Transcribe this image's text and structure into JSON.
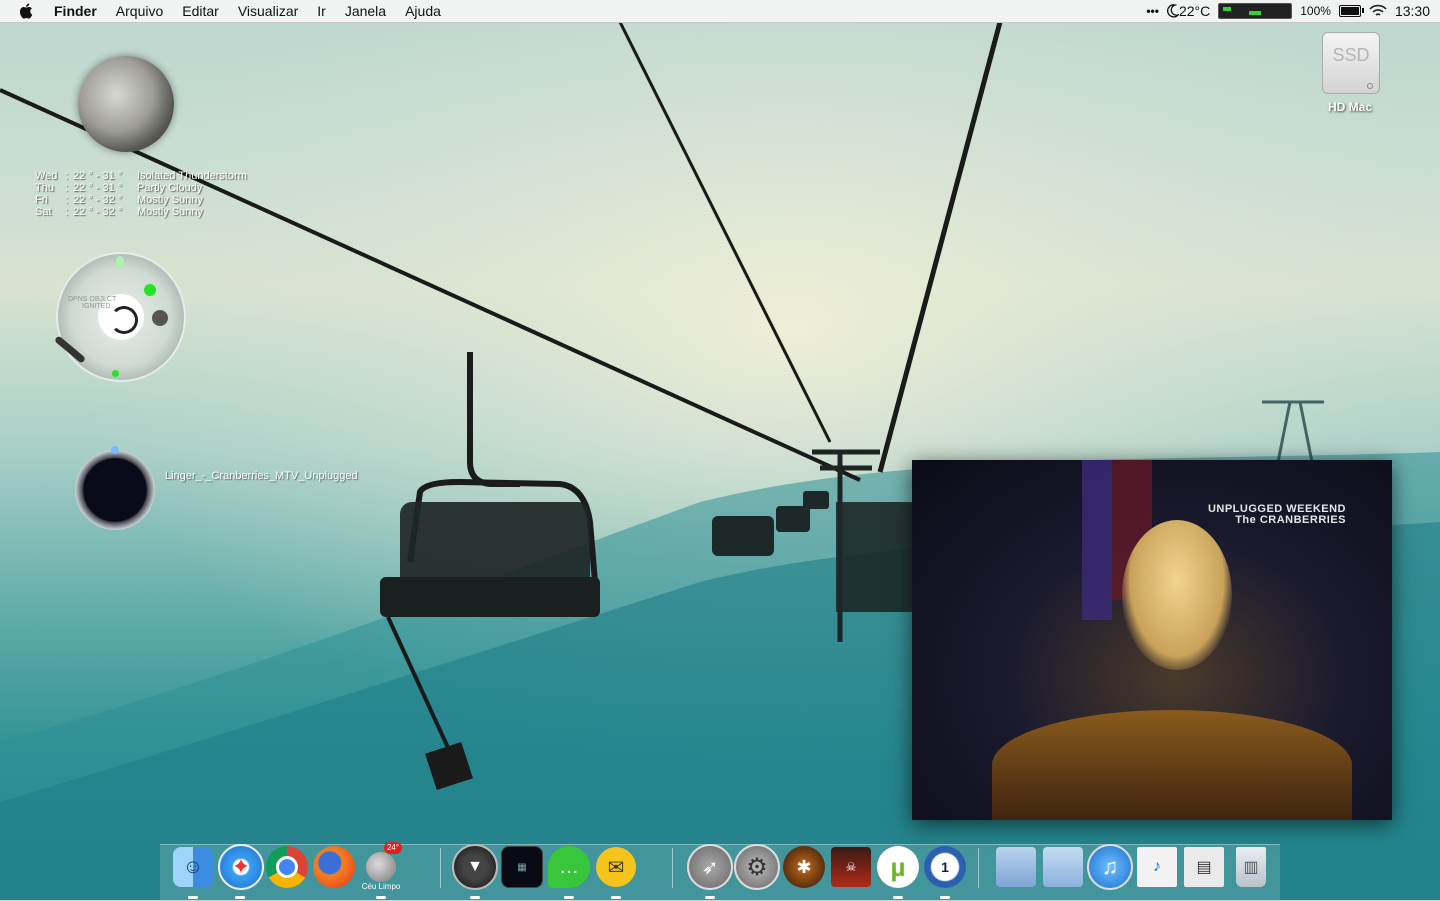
{
  "menubar": {
    "app_name": "Finder",
    "items": [
      "Arquivo",
      "Editar",
      "Visualizar",
      "Ir",
      "Janela",
      "Ajuda"
    ],
    "status": {
      "dots": "•••",
      "temperature": "22°C",
      "battery_percent": "100%",
      "time": "13:30"
    }
  },
  "weather_widget": {
    "rows": [
      {
        "day": "Wed",
        "temps": "22 ° - 31 °",
        "condition": "Isolated Thunderstorm"
      },
      {
        "day": "Thu",
        "temps": "22 ° - 31 °",
        "condition": "Partly Cloudy"
      },
      {
        "day": "Fri",
        "temps": "22 ° - 32 °",
        "condition": "Mostly Sunny"
      },
      {
        "day": "Sat",
        "temps": "22 ° - 32 °",
        "condition": "Mostly Sunny"
      }
    ]
  },
  "clock_widget": {
    "labels": [
      "DPNS OBJLCT",
      "IGNITED"
    ]
  },
  "music_widget": {
    "track": "Linger_-_Cranberries_MTV_Unplugged"
  },
  "desktop": {
    "hd_icon_text": "SSD",
    "hd_label": "HD Mac"
  },
  "video": {
    "overlay_line1": "UNPLUGGED WEEKEND",
    "overlay_line2": "The CRANBERRIES"
  },
  "dock": {
    "ceu_limpo_caption": "Céu Limpo",
    "ceu_limpo_badge": "24°"
  },
  "colors": {
    "accent_green": "#27e327"
  }
}
